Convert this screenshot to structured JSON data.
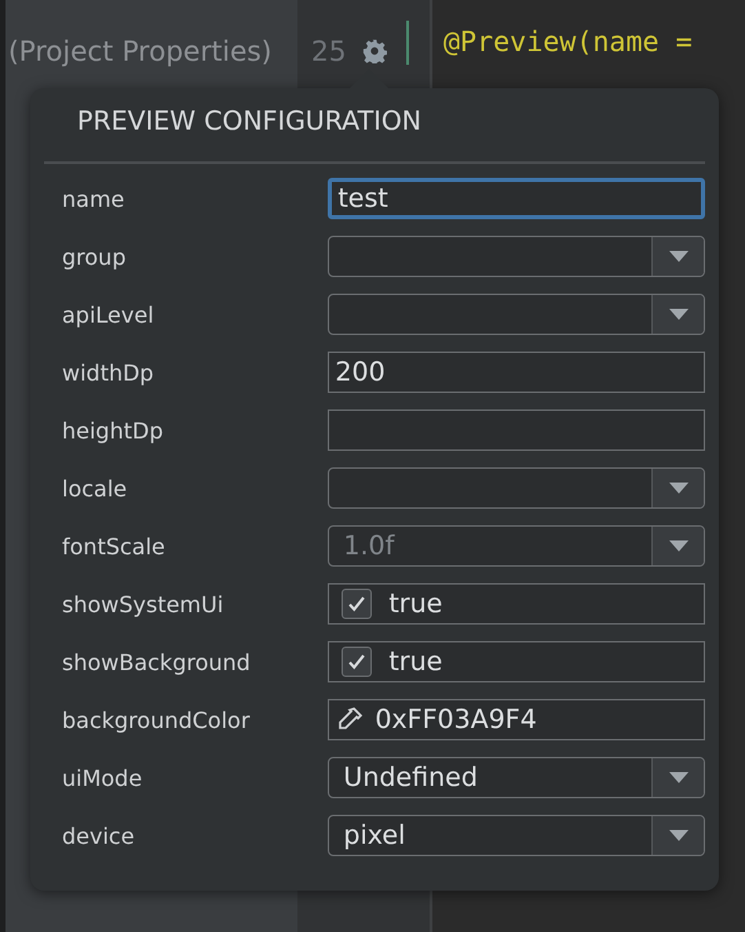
{
  "project_tree": {
    "items": [
      "(Project Properties)"
    ]
  },
  "editor": {
    "line_numbers": [
      "25"
    ],
    "code_line": "@Preview(name = "
  },
  "popup": {
    "title": "PREVIEW CONFIGURATION",
    "fields": [
      {
        "label": "name",
        "kind": "text",
        "value": "test",
        "focused": true
      },
      {
        "label": "group",
        "kind": "dropdown"
      },
      {
        "label": "apiLevel",
        "kind": "dropdown"
      },
      {
        "label": "widthDp",
        "kind": "text",
        "value": "200",
        "focused": false
      },
      {
        "label": "heightDp",
        "kind": "text",
        "focused": false
      },
      {
        "label": "locale",
        "kind": "dropdown"
      },
      {
        "label": "fontScale",
        "kind": "dropdown",
        "placeholder": "1.0f"
      },
      {
        "label": "showSystemUi",
        "kind": "checkbox",
        "checked": true,
        "value": "true"
      },
      {
        "label": "showBackground",
        "kind": "checkbox",
        "checked": true,
        "value": "true"
      },
      {
        "label": "backgroundColor",
        "kind": "color",
        "value": "0xFF03A9F4"
      },
      {
        "label": "uiMode",
        "kind": "dropdown",
        "value": "Undefined"
      },
      {
        "label": "device",
        "kind": "dropdown",
        "value": "pixel"
      }
    ]
  }
}
